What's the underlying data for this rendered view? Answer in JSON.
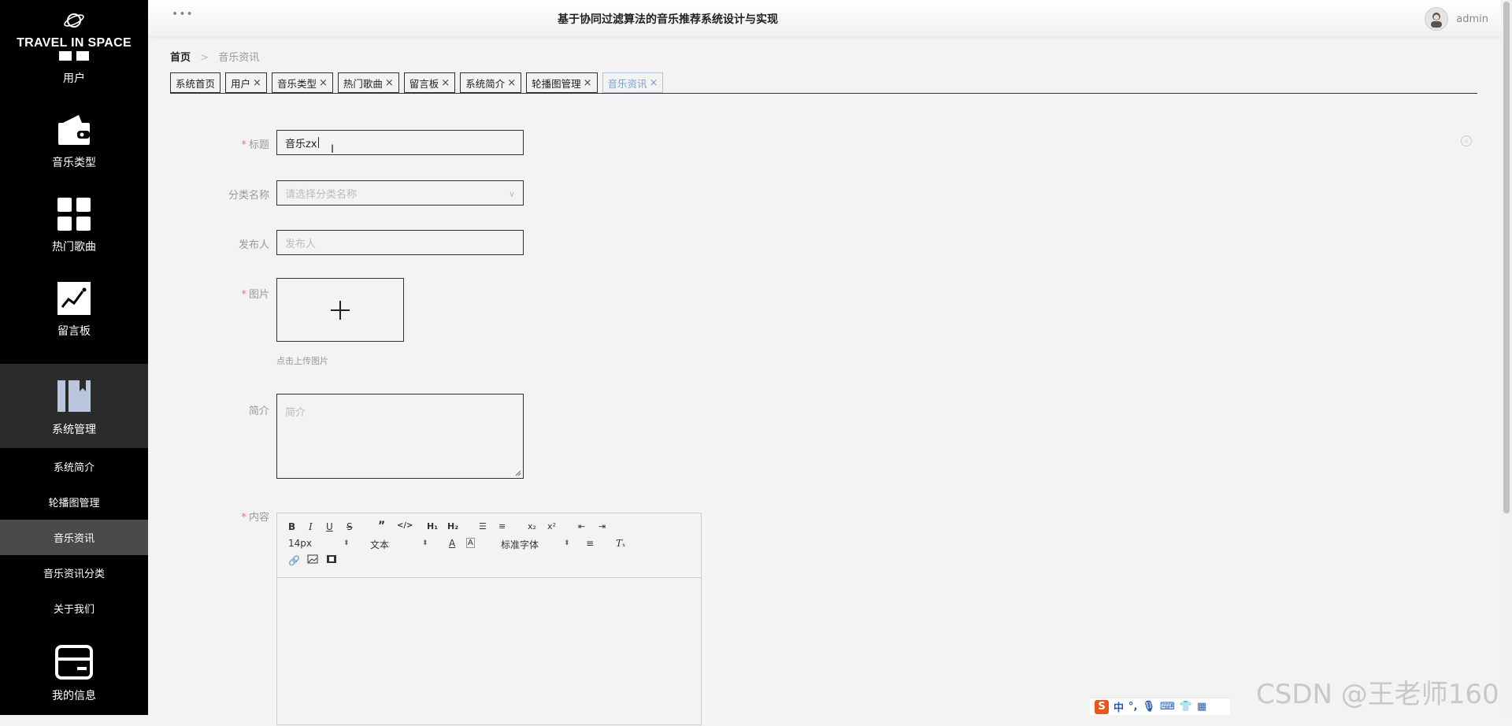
{
  "sidebar": {
    "brand": "TRAVEL IN SPACE",
    "items": [
      {
        "label": "用户",
        "icon": "grid-icon"
      },
      {
        "label": "音乐类型",
        "icon": "wallet-icon"
      },
      {
        "label": "热门歌曲",
        "icon": "grid-icon"
      },
      {
        "label": "留言板",
        "icon": "chart-icon"
      },
      {
        "label": "系统管理",
        "icon": "book-icon"
      },
      {
        "label": "我的信息",
        "icon": "card-icon"
      }
    ],
    "sub_items": [
      "系统简介",
      "轮播图管理",
      "音乐资讯",
      "音乐资讯分类",
      "关于我们"
    ],
    "active_sub": "音乐资讯"
  },
  "header": {
    "title": "基于协同过滤算法的音乐推荐系统设计与实现",
    "username": "admin"
  },
  "breadcrumb": {
    "home": "首页",
    "current": "音乐资讯"
  },
  "tabs": [
    {
      "label": "系统首页",
      "closable": false
    },
    {
      "label": "用户",
      "closable": true
    },
    {
      "label": "音乐类型",
      "closable": true
    },
    {
      "label": "热门歌曲",
      "closable": true
    },
    {
      "label": "留言板",
      "closable": true
    },
    {
      "label": "系统简介",
      "closable": true
    },
    {
      "label": "轮播图管理",
      "closable": true
    },
    {
      "label": "音乐资讯",
      "closable": true,
      "active": true
    }
  ],
  "form": {
    "title": {
      "label": "标题",
      "value": "音乐zx"
    },
    "category": {
      "label": "分类名称",
      "placeholder": "请选择分类名称"
    },
    "publisher": {
      "label": "发布人",
      "placeholder": "发布人"
    },
    "image": {
      "label": "图片",
      "hint": "点击上传图片"
    },
    "intro": {
      "label": "简介",
      "placeholder": "简介"
    },
    "content": {
      "label": "内容"
    }
  },
  "editor": {
    "font_size": "14px",
    "text_type": "文本",
    "font_family": "标准字体"
  },
  "ime": {
    "label": "中"
  },
  "watermark": "CSDN @王老师160",
  "colors": {
    "sidebar_bg": "#000000",
    "active_tab": "#7aa0d0",
    "required": "#f56c6c"
  }
}
